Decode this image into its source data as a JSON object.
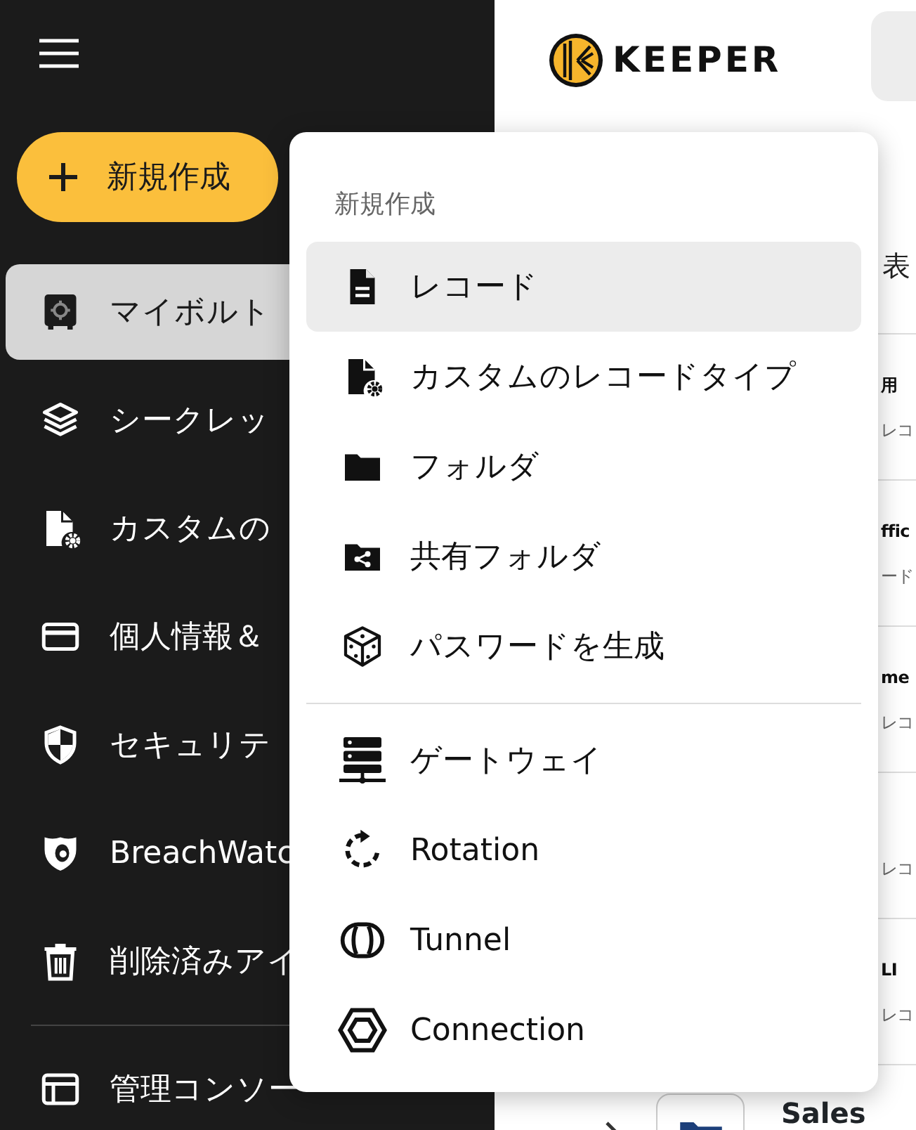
{
  "sidebar": {
    "new_button": {
      "label": "新規作成"
    },
    "items": [
      {
        "label": "マイボルト",
        "selected": true
      },
      {
        "label": "シークレッ",
        "selected": false
      },
      {
        "label": "カスタムの",
        "selected": false
      },
      {
        "label": "個人情報＆",
        "selected": false
      },
      {
        "label": "セキュリテ",
        "selected": false
      },
      {
        "label": "BreachWatc",
        "selected": false
      },
      {
        "label": "削除済みアイ",
        "selected": false
      }
    ],
    "footer_items": [
      {
        "label": "管理コンソー",
        "selected": false
      }
    ]
  },
  "header": {
    "logo": "KEEPER"
  },
  "list": {
    "column_header": "表",
    "rows": [
      {
        "title": "用",
        "subtitle": "レコ"
      },
      {
        "title": "ffic",
        "subtitle": "ード"
      },
      {
        "title": "me",
        "subtitle": "レコ"
      },
      {
        "subtitle": "レコ"
      },
      {
        "title": "LI",
        "subtitle": "レコ"
      }
    ],
    "folder_row": {
      "title": "Sales"
    }
  },
  "new_menu": {
    "heading": "新規作成",
    "groups": [
      [
        {
          "label": "レコード",
          "selected": true
        },
        {
          "label": "カスタムのレコードタイプ",
          "selected": false
        },
        {
          "label": "フォルダ",
          "selected": false
        },
        {
          "label": "共有フォルダ",
          "selected": false
        },
        {
          "label": "パスワードを生成",
          "selected": false
        }
      ],
      [
        {
          "label": "ゲートウェイ",
          "selected": false
        },
        {
          "label": "Rotation",
          "selected": false
        },
        {
          "label": "Tunnel",
          "selected": false
        },
        {
          "label": "Connection",
          "selected": false
        }
      ]
    ]
  }
}
